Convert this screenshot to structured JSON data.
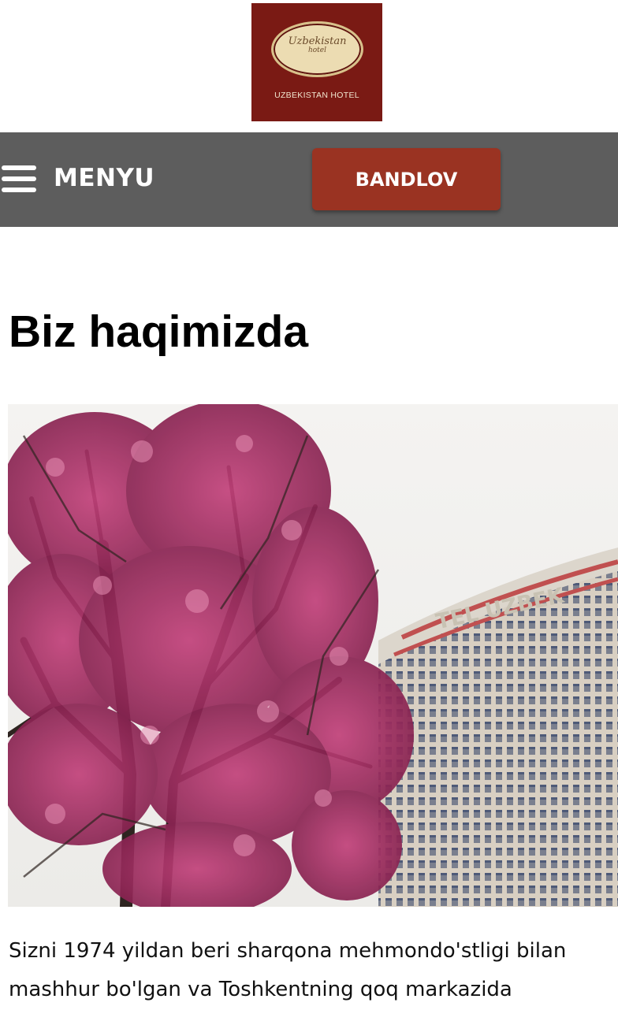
{
  "header": {
    "logo": {
      "oval_line1": "Uzbekistan",
      "oval_line2": "hotel",
      "caption": "UZBEKISTAN HOTEL"
    }
  },
  "navbar": {
    "menu_icon": "hamburger-icon",
    "menu_label": "MENYU",
    "book_label": "BANDLOV",
    "book_color": "#9a3322",
    "bar_color": "#5d5d5d"
  },
  "main": {
    "title": "Biz haqimizda",
    "hero_image": {
      "sign_text": "TEL UZBEK"
    },
    "intro": "Sizni 1974 yildan beri sharqona mehmondo'stligi bilan mashhur bo'lgan va Toshkentning qoq markazida"
  }
}
